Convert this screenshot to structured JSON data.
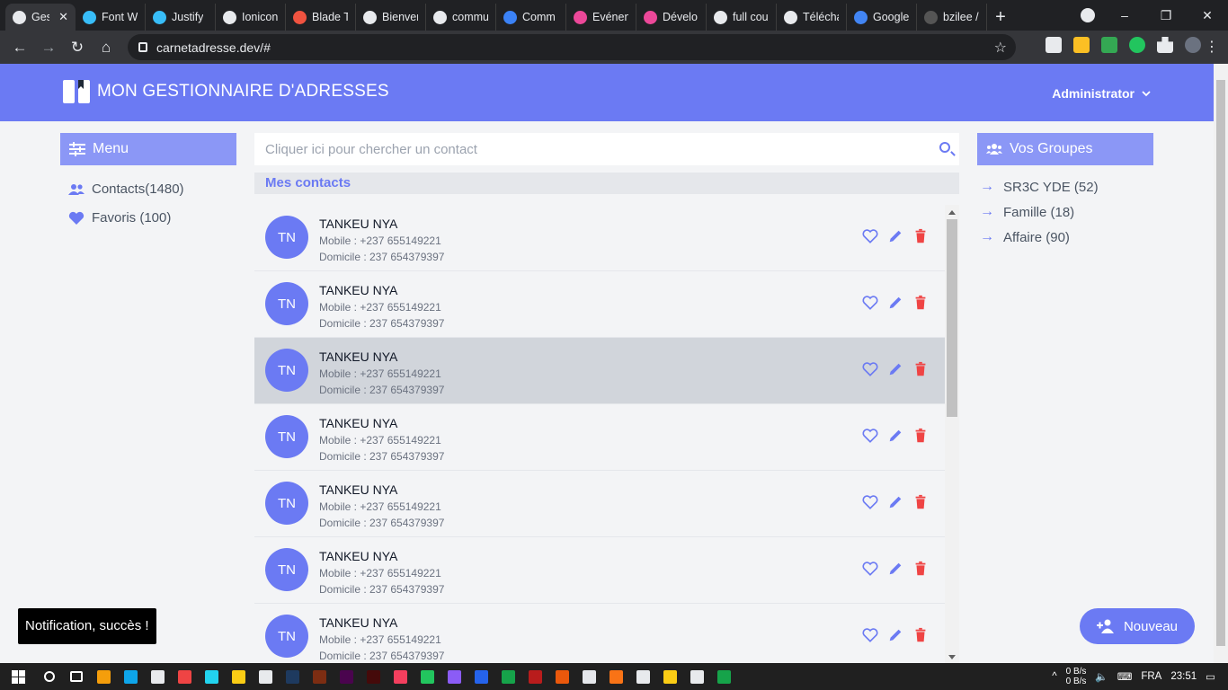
{
  "browser": {
    "tabs": [
      {
        "title": "Ges",
        "favicon_color": "#e8eaed",
        "active": true
      },
      {
        "title": "Font W",
        "favicon_color": "#38bdf8"
      },
      {
        "title": "Justify",
        "favicon_color": "#38bdf8"
      },
      {
        "title": "Ionicon",
        "favicon_color": "#e8eaed"
      },
      {
        "title": "Blade T",
        "favicon_color": "#f05340"
      },
      {
        "title": "Bienver",
        "favicon_color": "#e8eaed"
      },
      {
        "title": "commu",
        "favicon_color": "#e8eaed"
      },
      {
        "title": "Comm",
        "favicon_color": "#3b82f6"
      },
      {
        "title": "Evénen",
        "favicon_color": "#ec4899"
      },
      {
        "title": "Dévelo",
        "favicon_color": "#ec4899"
      },
      {
        "title": "full cou",
        "favicon_color": "#e8eaed"
      },
      {
        "title": "Télécha",
        "favicon_color": "#e8eaed"
      },
      {
        "title": "Google",
        "favicon_color": "#4285f4"
      },
      {
        "title": "bzilee /",
        "favicon_color": "#555555"
      }
    ],
    "new_tab": "+",
    "url": "carnetadresse.dev/#",
    "window_controls": [
      "–",
      "❐",
      "✕"
    ]
  },
  "app": {
    "brand": "MON GESTIONNAIRE D'ADRESSES",
    "user_menu": "Administrator",
    "colors": {
      "primary": "#6b7af3",
      "primary_light": "#8b97f6",
      "danger": "#ef4444"
    }
  },
  "sidebar": {
    "heading": "Menu",
    "items": [
      {
        "label": "Contacts(1480)",
        "icon": "users-icon"
      },
      {
        "label": "Favoris (100)",
        "icon": "heart-icon"
      }
    ]
  },
  "search": {
    "placeholder": "Cliquer ici pour chercher un contact"
  },
  "list": {
    "heading": "Mes contacts",
    "contacts": [
      {
        "initials": "TN",
        "name": "TANKEU NYA",
        "mobile": "Mobile : +237 655149221",
        "home": "Domicile : 237 654379397"
      },
      {
        "initials": "TN",
        "name": "TANKEU NYA",
        "mobile": "Mobile : +237 655149221",
        "home": "Domicile : 237 654379397"
      },
      {
        "initials": "TN",
        "name": "TANKEU NYA",
        "mobile": "Mobile : +237 655149221",
        "home": "Domicile : 237 654379397",
        "highlighted": true
      },
      {
        "initials": "TN",
        "name": "TANKEU NYA",
        "mobile": "Mobile : +237 655149221",
        "home": "Domicile : 237 654379397"
      },
      {
        "initials": "TN",
        "name": "TANKEU NYA",
        "mobile": "Mobile : +237 655149221",
        "home": "Domicile : 237 654379397"
      },
      {
        "initials": "TN",
        "name": "TANKEU NYA",
        "mobile": "Mobile : +237 655149221",
        "home": "Domicile : 237 654379397"
      },
      {
        "initials": "TN",
        "name": "TANKEU NYA",
        "mobile": "Mobile : +237 655149221",
        "home": "Domicile : 237 654379397"
      }
    ]
  },
  "groups": {
    "heading": "Vos Groupes",
    "items": [
      {
        "label": "SR3C YDE (52)"
      },
      {
        "label": "Famille (18)"
      },
      {
        "label": "Affaire (90)"
      }
    ]
  },
  "toast": "Notification, succès !",
  "fab_label": "Nouveau",
  "taskbar": {
    "apps": [
      "#f59e0b",
      "#0ea5e9",
      "#e8eaed",
      "#ef4444",
      "#22d3ee",
      "#facc15",
      "#e8eaed",
      "#1e3a5f",
      "#7c2d12",
      "#4a044e",
      "#450a0a",
      "#f43f5e",
      "#22c55e",
      "#8b5cf6",
      "#2563eb",
      "#16a34a",
      "#b91c1c",
      "#ea580c",
      "#e5e7eb",
      "#f97316",
      "#e8eaed",
      "#facc15",
      "#e8eaed",
      "#16a34a"
    ],
    "net_up": "0 B/s",
    "net_down": "0 B/s",
    "lang": "FRA",
    "time": "23:51"
  }
}
